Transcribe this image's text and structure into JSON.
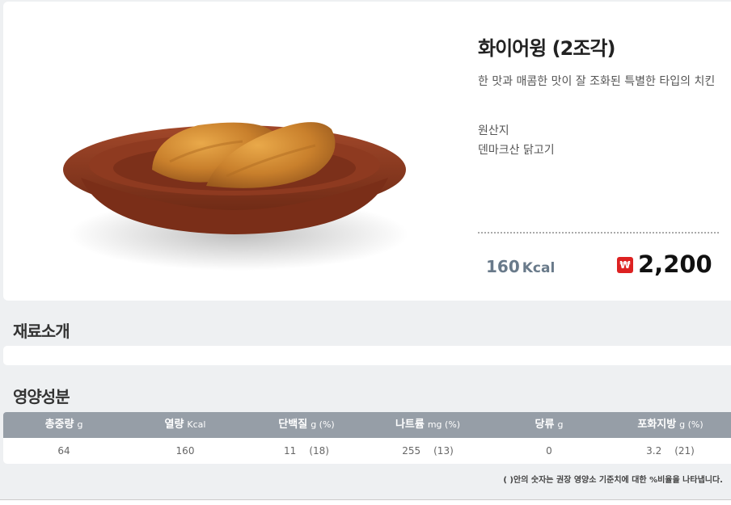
{
  "product": {
    "name": "화이어윙 (2조각)",
    "description": "한 맛과 매콤한 맛이 잘 조화된 특별한 타입의 치킨",
    "origin_label": "원산지",
    "origin_value": "덴마크산 닭고기",
    "kcal_value": "160",
    "kcal_unit": "Kcal",
    "currency_symbol": "₩",
    "price": "2,200",
    "image_icon": "fried-chicken-on-plate"
  },
  "sections": {
    "ingredients_title": "재료소개",
    "nutrition_title": "영양성분"
  },
  "nutrition": {
    "headers": [
      {
        "label": "총중량",
        "unit": "g"
      },
      {
        "label": "열량",
        "unit": "Kcal"
      },
      {
        "label": "단백질",
        "unit": "g (%)"
      },
      {
        "label": "나트륨",
        "unit": "mg (%)"
      },
      {
        "label": "당류",
        "unit": "g"
      },
      {
        "label": "포화지방",
        "unit": "g (%)"
      }
    ],
    "values": [
      {
        "value": "64",
        "pct": ""
      },
      {
        "value": "160",
        "pct": ""
      },
      {
        "value": "11",
        "pct": "(18)"
      },
      {
        "value": "255",
        "pct": "(13)"
      },
      {
        "value": "0",
        "pct": ""
      },
      {
        "value": "3.2",
        "pct": "(21)"
      }
    ],
    "footnote": "( )안의 숫자는 권장 영양소 기준치에 대한 %비율을 나타냅니다."
  },
  "colors": {
    "price_icon": "#dd2222",
    "table_header": "#969ea7",
    "kcal_text": "#697a8a"
  }
}
